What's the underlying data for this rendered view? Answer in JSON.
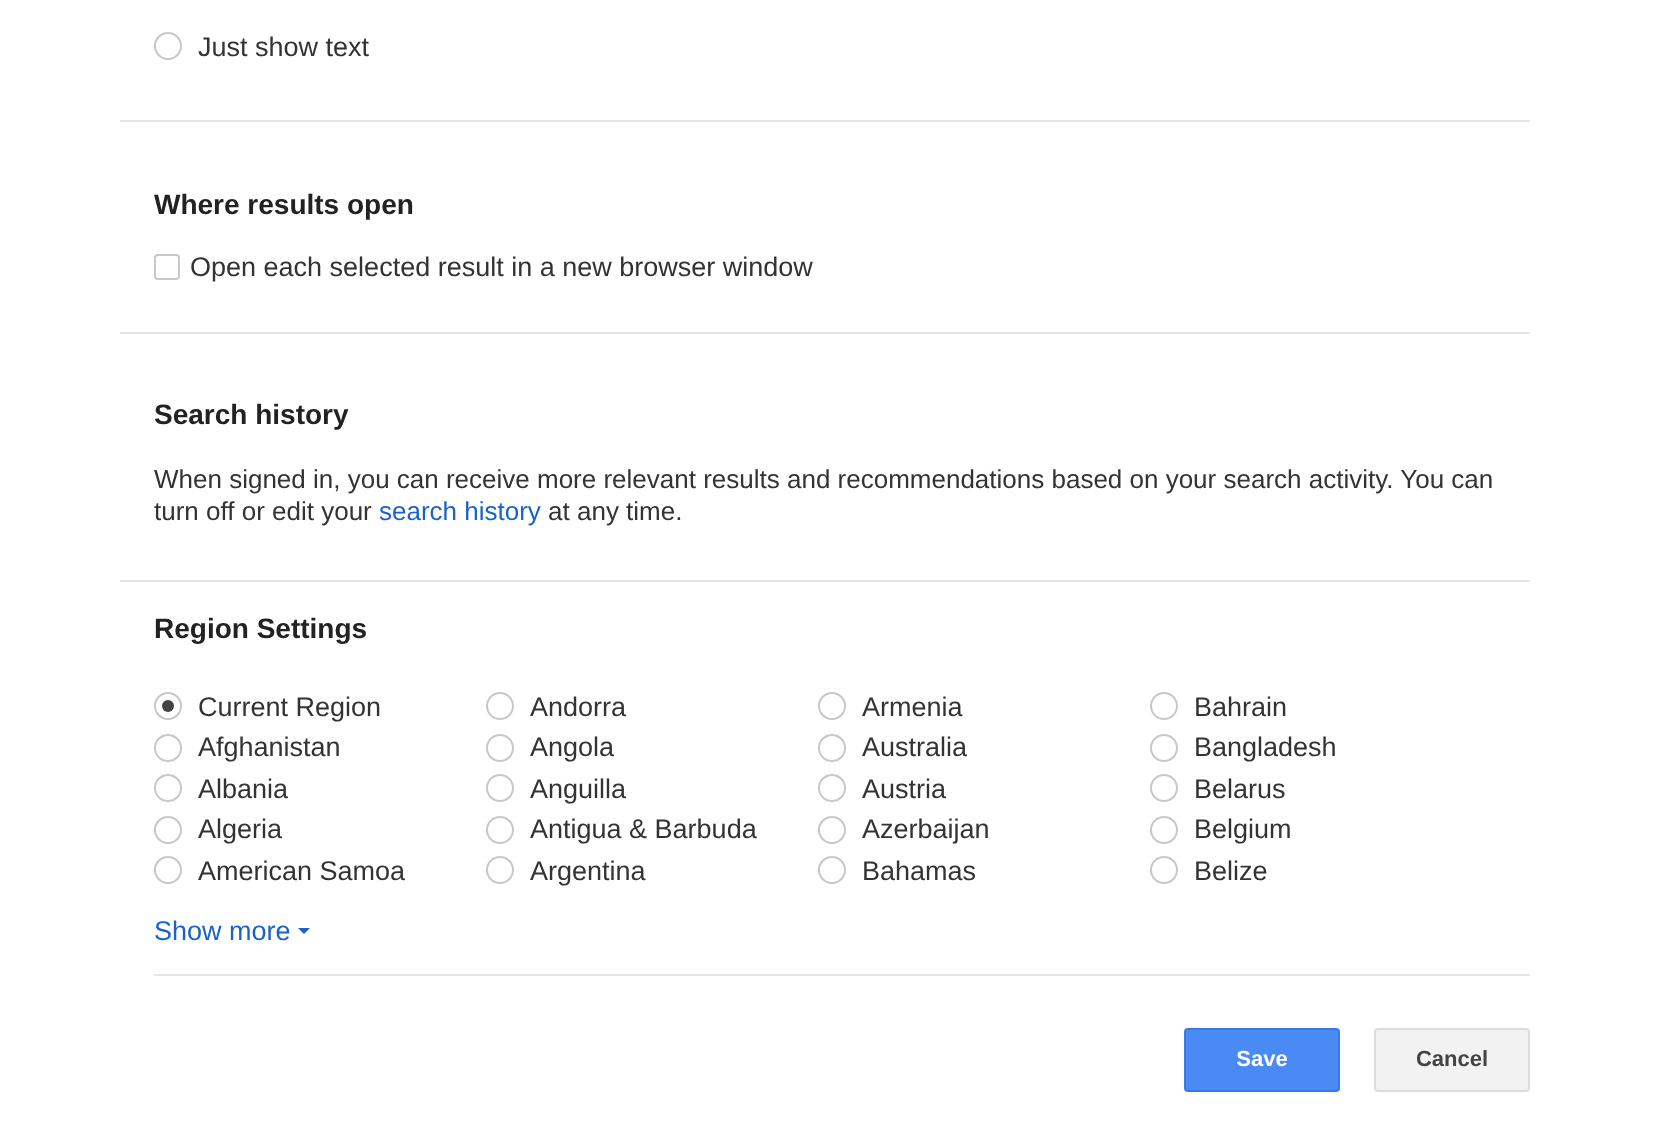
{
  "voice_output": {
    "options": [
      {
        "label": "Just show text",
        "selected": false
      }
    ]
  },
  "where_results_open": {
    "title": "Where results open",
    "checkbox": {
      "label": "Open each selected result in a new browser window",
      "checked": false
    }
  },
  "search_history": {
    "title": "Search history",
    "text": "When signed in, you can receive more relevant results and recommendations based on your search activity. You can turn off or edit your",
    "link": "search history",
    "text_after": "at any time."
  },
  "region_settings": {
    "title": "Region Settings",
    "regions": [
      {
        "label": "Current Region",
        "selected": true
      },
      {
        "label": "Afghanistan",
        "selected": false
      },
      {
        "label": "Albania",
        "selected": false
      },
      {
        "label": "Algeria",
        "selected": false
      },
      {
        "label": "American Samoa",
        "selected": false
      },
      {
        "label": "Andorra",
        "selected": false
      },
      {
        "label": "Angola",
        "selected": false
      },
      {
        "label": "Anguilla",
        "selected": false
      },
      {
        "label": "Antigua & Barbuda",
        "selected": false
      },
      {
        "label": "Argentina",
        "selected": false
      },
      {
        "label": "Armenia",
        "selected": false
      },
      {
        "label": "Australia",
        "selected": false
      },
      {
        "label": "Austria",
        "selected": false
      },
      {
        "label": "Azerbaijan",
        "selected": false
      },
      {
        "label": "Bahamas",
        "selected": false
      },
      {
        "label": "Bahrain",
        "selected": false
      },
      {
        "label": "Bangladesh",
        "selected": false
      },
      {
        "label": "Belarus",
        "selected": false
      },
      {
        "label": "Belgium",
        "selected": false
      },
      {
        "label": "Belize",
        "selected": false
      }
    ],
    "show_more": "Show more"
  },
  "buttons": [
    {
      "label": "Save",
      "kind": "primary"
    },
    {
      "label": "Cancel",
      "kind": "secondary"
    }
  ]
}
